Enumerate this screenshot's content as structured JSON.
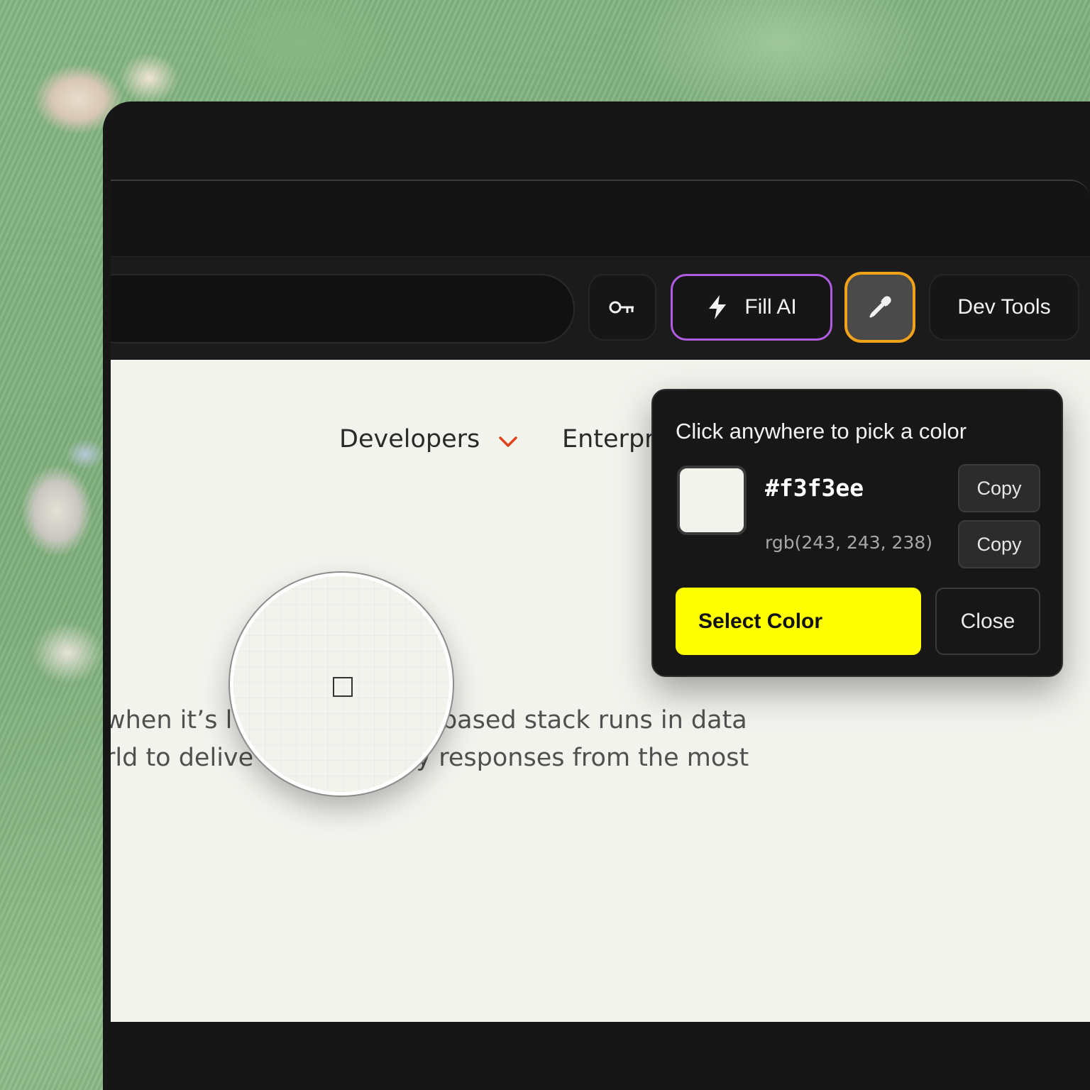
{
  "toolbar": {
    "key_icon": "key-icon",
    "fill_ai": {
      "icon": "lightning-icon",
      "label": "Fill AI",
      "border_color": "#b15be0"
    },
    "picker": {
      "icon": "eyedropper-icon",
      "active_border_color": "#f0a319"
    },
    "dev_tools_label": "Dev Tools"
  },
  "page": {
    "nav": {
      "developers": "Developers",
      "enterprise": "Enterpr",
      "chevron_color": "#e0431b"
    },
    "body_lines": [
      "when it’s l",
      "-based stack runs in data",
      "rld to delive",
      "cy responses from the most"
    ],
    "background_color": "#f3f3ee"
  },
  "color_picker": {
    "title": "Click anywhere to pick a color",
    "hex": "#f3f3ee",
    "rgb": "rgb(243, 243, 238)",
    "copy_hex_label": "Copy",
    "copy_rgb_label": "Copy",
    "select_label": "Select Color",
    "close_label": "Close",
    "select_color": "#ffff00"
  }
}
